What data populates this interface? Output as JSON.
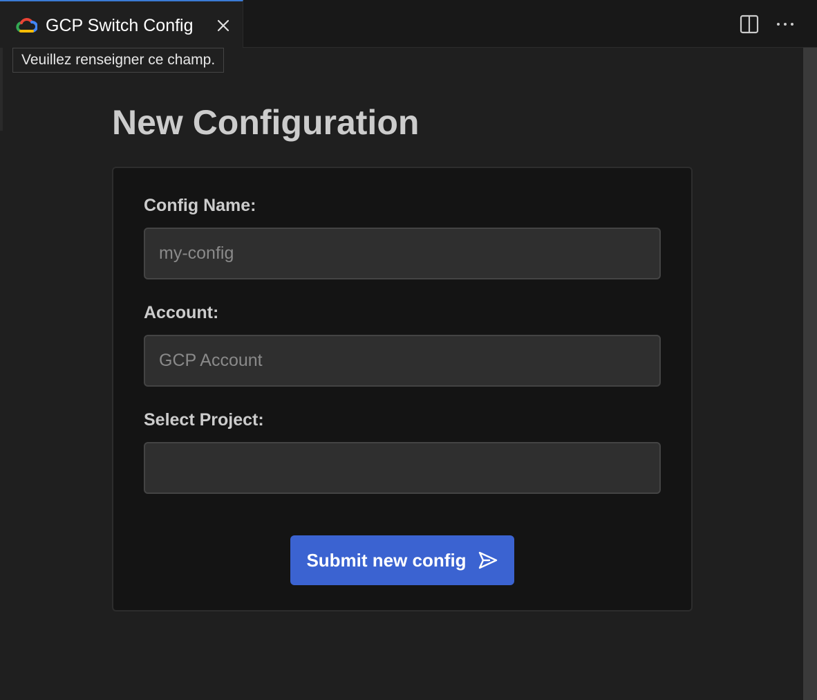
{
  "tab": {
    "title": "GCP Switch Config",
    "icon": "google-cloud-icon",
    "close_icon": "close-icon"
  },
  "toolbar": {
    "split_icon": "split-editor-icon",
    "more_icon": "more-actions-icon"
  },
  "tooltip": {
    "text": "Veuillez renseigner ce champ."
  },
  "page": {
    "title": "New Configuration"
  },
  "form": {
    "config_name_label": "Config Name:",
    "config_name_placeholder": "my-config",
    "config_name_value": "",
    "account_label": "Account:",
    "account_placeholder": "GCP Account",
    "account_value": "",
    "project_label": "Select Project:",
    "project_value": "",
    "submit_label": "Submit new config",
    "submit_icon": "send-icon"
  },
  "colors": {
    "accent": "#3b63d1",
    "tab_highlight": "#3b7bd6",
    "background": "#1f1f1f",
    "card": "#141414"
  }
}
